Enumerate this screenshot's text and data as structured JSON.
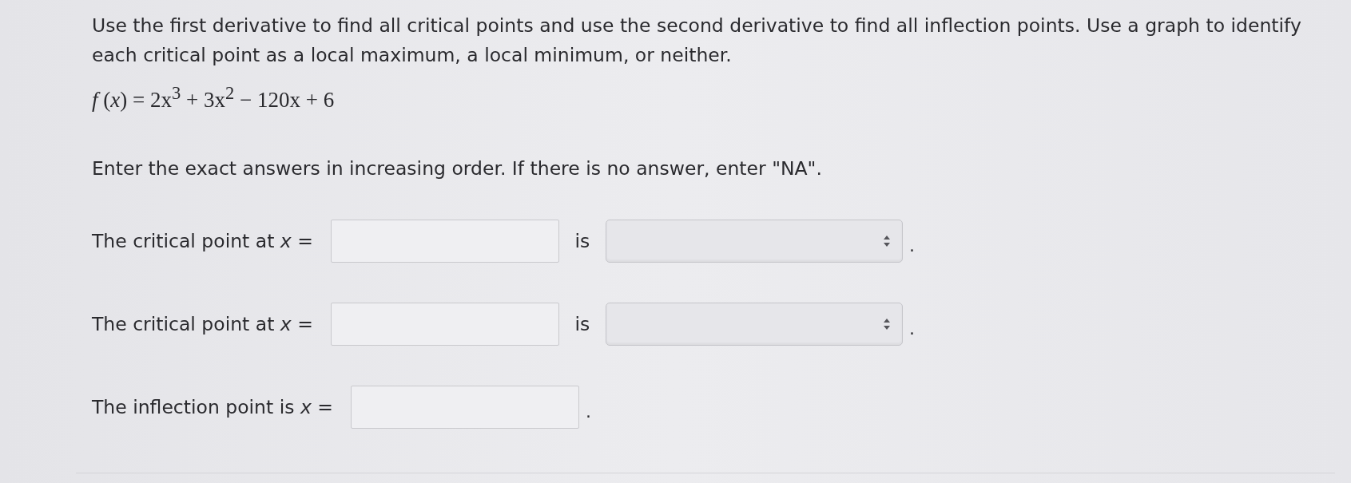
{
  "instructions": "Use the first derivative to find all critical points and use the second derivative to find all inflection points. Use a graph to identify each critical point as a local maximum, a local minimum, or neither.",
  "equation": "*f* (*x*) = 2x$^{3}$ + 3x$^{2}$ − 120x + 6",
  "note": "Enter the exact answers in increasing order. If there is no answer, enter \"NA\".",
  "rows": [
    {
      "kind": "classify",
      "label": "The critical point at *x* =",
      "connector": "is",
      "end": "."
    },
    {
      "kind": "classify",
      "label": "The critical point at *x* =",
      "connector": "is",
      "end": "."
    },
    {
      "kind": "single",
      "label": "The inflection point is *x* =",
      "end": "."
    }
  ]
}
